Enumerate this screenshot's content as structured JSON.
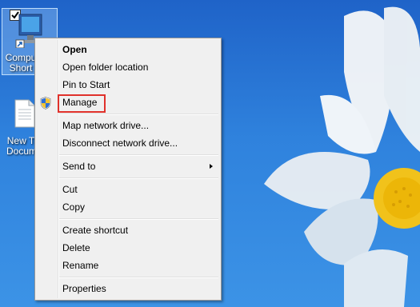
{
  "desktop": {
    "icons": [
      {
        "label_line1": "Compu",
        "label_line2": "Short"
      },
      {
        "label_line1": "New T",
        "label_line2": "Docum"
      }
    ]
  },
  "context_menu": {
    "items": [
      {
        "label": "Open",
        "bold": true
      },
      {
        "label": "Open folder location"
      },
      {
        "label": "Pin to Start"
      },
      {
        "label": "Manage",
        "icon": "shield-icon",
        "highlighted": true
      },
      {
        "label": "Map network drive..."
      },
      {
        "label": "Disconnect network drive..."
      },
      {
        "label": "Send to",
        "submenu": true
      },
      {
        "label": "Cut"
      },
      {
        "label": "Copy"
      },
      {
        "label": "Create shortcut"
      },
      {
        "label": "Delete"
      },
      {
        "label": "Rename"
      },
      {
        "label": "Properties"
      }
    ]
  },
  "colors": {
    "highlight_border": "#e0312b",
    "wallpaper_blue": "#2f82dd"
  }
}
